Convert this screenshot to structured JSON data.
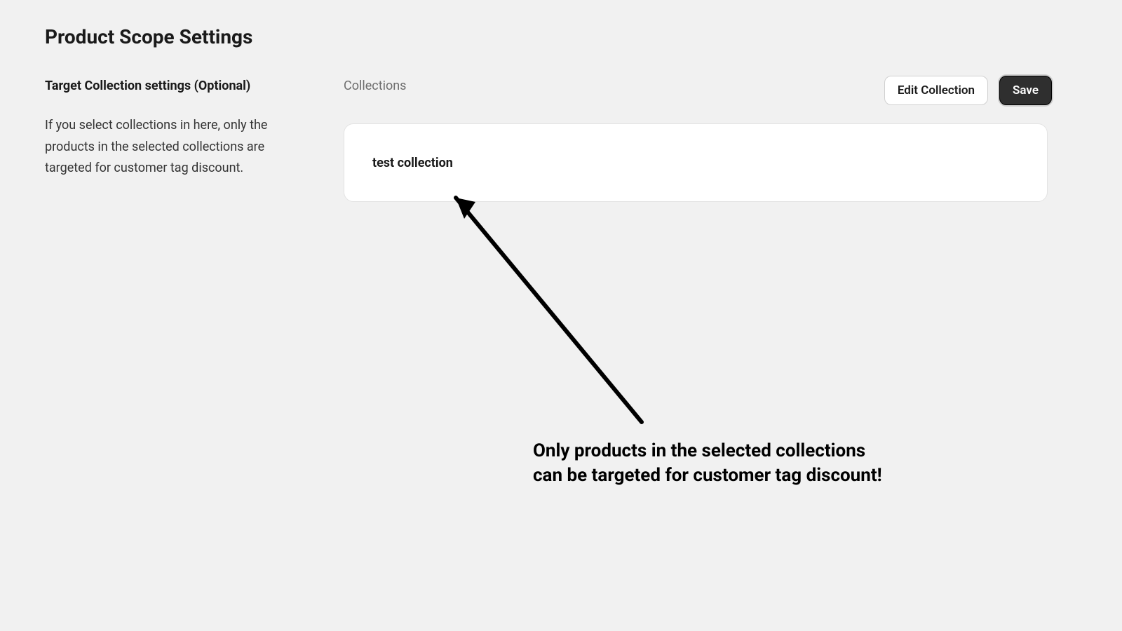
{
  "header": {
    "title": "Product Scope Settings"
  },
  "sidebar": {
    "section_heading": "Target Collection settings (Optional)",
    "section_description": "If you select collections in here, only the products in the selected collections are targeted for customer tag discount."
  },
  "main": {
    "collections_label": "Collections",
    "buttons": {
      "edit_label": "Edit Collection",
      "save_label": "Save"
    },
    "card": {
      "collection_name": "test collection"
    }
  },
  "annotation": {
    "text": "Only products in the selected collections\ncan be targeted for customer tag discount!"
  }
}
